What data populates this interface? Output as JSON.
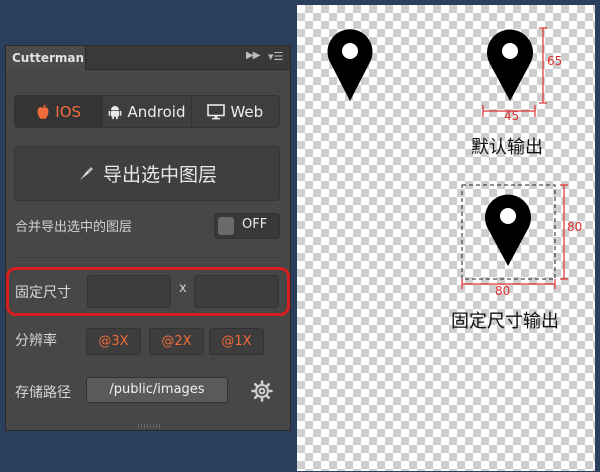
{
  "panel": {
    "title": "Cutterman",
    "platforms": [
      {
        "label": "IOS",
        "icon": "apple-icon",
        "active": true
      },
      {
        "label": "Android",
        "icon": "android-icon",
        "active": false
      },
      {
        "label": "Web",
        "icon": "monitor-icon",
        "active": false
      }
    ],
    "export_label": "导出选中图层",
    "merge_label": "合并导出选中的图层",
    "merge_toggle": "OFF",
    "fixed_size_label": "固定尺寸",
    "fixed_width_value": "",
    "fixed_height_value": "",
    "times_sign": "x",
    "resolution_label": "分辨率",
    "scales": [
      "@3X",
      "@2X",
      "@1X"
    ],
    "path_label": "存储路径",
    "path_value": "/public/images"
  },
  "canvas": {
    "label_height": "65",
    "label_width": "45",
    "default_caption": "默认输出",
    "fixed_label_side": "80",
    "fixed_label_bottom": "80",
    "fixed_caption": "固定尺寸输出"
  },
  "colors": {
    "accent": "#f26b3a",
    "highlight_box": "#d81e1e",
    "dimension_line": "#e03030"
  }
}
